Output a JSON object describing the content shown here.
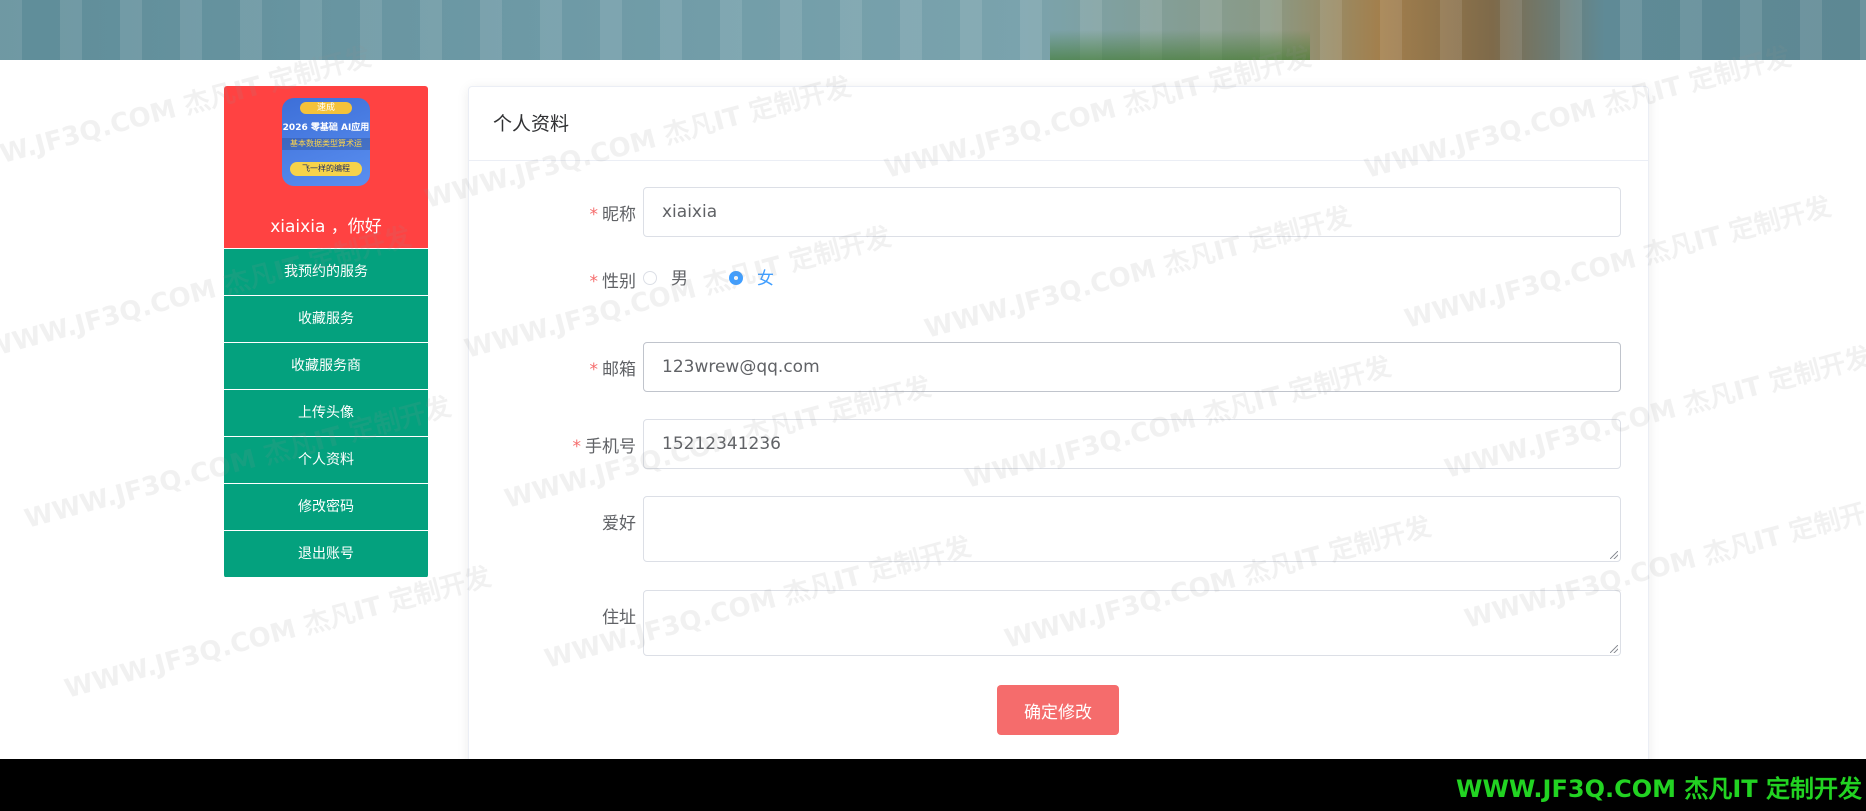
{
  "sidebar": {
    "avatar": {
      "tag": "速成",
      "line1": "2026 零基础 AI应用",
      "line2": "基本数据类型算术运",
      "line3": "飞一样的编程"
    },
    "greeting": "xiaixia ，你好",
    "menu": [
      "我预约的服务",
      "收藏服务",
      "收藏服务商",
      "上传头像",
      "个人资料",
      "修改密码",
      "退出账号"
    ]
  },
  "panel": {
    "title": "个人资料",
    "form": {
      "nickname": {
        "label": "昵称",
        "value": "xiaixia"
      },
      "gender": {
        "label": "性别",
        "options": [
          "男",
          "女"
        ],
        "selected": "女"
      },
      "email": {
        "label": "邮箱",
        "value": "123wrew@qq.com"
      },
      "phone": {
        "label": "手机号",
        "value": "15212341236"
      },
      "hobby": {
        "label": "爱好",
        "value": ""
      },
      "address": {
        "label": "住址",
        "value": ""
      }
    },
    "submit_label": "确定修改"
  },
  "footer": {
    "brand": "WWW.JF3Q.COM 杰凡IT  定制开发"
  },
  "watermark": {
    "text": "WWW.JF3Q.COM 杰凡IT  定制开发"
  },
  "colors": {
    "sidebar_header": "#ff4242",
    "menu_bg": "#04a17e",
    "submit_bg": "#f56c6c",
    "radio_checked": "#409eff",
    "required_star": "#f56c6c",
    "footer_brand": "#22d322"
  }
}
